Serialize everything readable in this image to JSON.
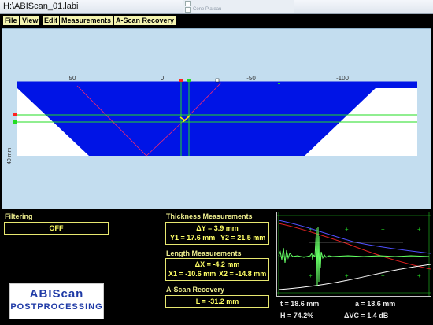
{
  "window": {
    "title": "H:\\ABIScan_01.labi"
  },
  "background_window": {
    "rows": [
      "",
      "Cone Plateau"
    ]
  },
  "menu": [
    {
      "id": "file",
      "label": "File"
    },
    {
      "id": "view",
      "label": "View"
    },
    {
      "id": "edit",
      "label": "Edit"
    },
    {
      "id": "measurements",
      "label": "Measurements"
    },
    {
      "id": "ascan-recovery",
      "label": "A-Scan Recovery"
    }
  ],
  "scan": {
    "x_ticks": [
      "50",
      "0",
      "-50",
      "-100"
    ],
    "depth_label": "40 mm",
    "colors": {
      "background": "#c3ddef",
      "specimen": "#0014e6",
      "bevel": "#ffffff",
      "cursor": "#22dd22",
      "beam": "#ff2a6a"
    }
  },
  "filtering": {
    "title": "Filtering",
    "value": "OFF"
  },
  "thickness": {
    "title": "Thickness Measurements",
    "delta_y": "ΔY = 3.9 mm",
    "y1": "Y1 = 17.6 mm",
    "y2": "Y2 = 21.5 mm"
  },
  "length": {
    "title": "Length Measurements",
    "delta_x": "ΔX = -4.2 mm",
    "x1": "X1 = -10.6 mm",
    "x2": "X2 = -14.8 mm"
  },
  "ascan_recovery": {
    "title": "A-Scan Recovery",
    "value": "L = -31.2 mm"
  },
  "logo": {
    "line1": "ABIScan",
    "line2": "POSTPROCESSING"
  },
  "ascan": {
    "t": "t = 18.6 mm",
    "a": "a = 18.6 mm",
    "h": "H = 74.2%",
    "dvc": "ΔVC = 1.4 dB",
    "colors": {
      "grid": "#22cc22",
      "signal": "#66ff66",
      "curve_red": "#e02020",
      "curve_blue": "#5050ff",
      "curve_white": "#ffffff"
    }
  }
}
